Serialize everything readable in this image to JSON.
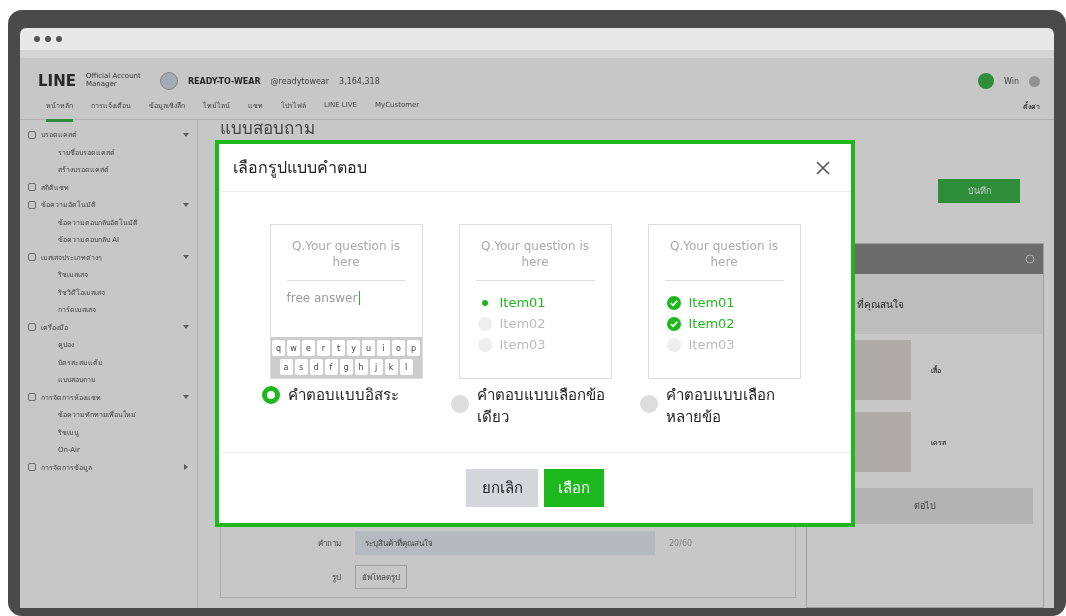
{
  "header": {
    "brand": "LINE",
    "brand_sub": "Official Account Manager",
    "account_name": "READY-TO-WEAR",
    "account_id": "@readytowear",
    "friends": "3,164,318",
    "user": "Win",
    "settings": "ตั้งค่า"
  },
  "nav": [
    {
      "label": "หน้าหลัก",
      "selected": true
    },
    {
      "label": "การแจ้งเตือน",
      "selected": false
    },
    {
      "label": "ข้อมูลเชิงลึก",
      "selected": false
    },
    {
      "label": "ไทม์ไลน์",
      "selected": false
    },
    {
      "label": "แชท",
      "selected": false
    },
    {
      "label": "โปรไฟล์",
      "selected": false
    },
    {
      "label": "LINE LIVE",
      "selected": false
    },
    {
      "label": "MyCustomer",
      "selected": false
    }
  ],
  "sidebar": [
    {
      "label": "บรอดแคสต์",
      "expanded": true,
      "children": [
        {
          "label": "รายชื่อบรอดแคสต์"
        },
        {
          "label": "สร้างบรอดแคสต์"
        }
      ]
    },
    {
      "label": "สถิติแชท"
    },
    {
      "label": "ข้อความอัตโนมัติ",
      "expanded": true,
      "children": [
        {
          "label": "ข้อความตอบกลับอัตโนมัติ"
        },
        {
          "label": "ข้อความตอบกลับ AI"
        }
      ]
    },
    {
      "label": "เมสเสจประเภทต่างๆ",
      "expanded": true,
      "children": [
        {
          "label": "ริชเมสเสจ"
        },
        {
          "label": "ริชวิดีโอเมสเสจ"
        },
        {
          "label": "การ์ดเมสเสจ"
        }
      ]
    },
    {
      "label": "เครื่องมือ",
      "expanded": true,
      "children": [
        {
          "label": "คูปอง"
        },
        {
          "label": "บัตรสะสมแต้ม"
        },
        {
          "label": "แบบสอบถาม"
        }
      ]
    },
    {
      "label": "การจัดการห้องแชท",
      "expanded": true,
      "children": [
        {
          "label": "ข้อความทักทายเพื่อนใหม่"
        },
        {
          "label": "ริชเมนู"
        },
        {
          "label": "On-Air"
        }
      ]
    },
    {
      "label": "การจัดการข้อมูล",
      "expanded": false
    }
  ],
  "page": {
    "title": "แบบสอบถาม",
    "save_button": "บันทึก",
    "form": [
      {
        "label": "คำถาม",
        "value": "ระบุสินค้าที่คุณสนใจ",
        "counter": "20/60"
      },
      {
        "label": "รูป",
        "button": "อัพโหลดรูป"
      }
    ],
    "preview": {
      "title": "ที่คุณสนใจ",
      "options": [
        {
          "label": "เสื้อ"
        },
        {
          "label": "เดรส"
        }
      ],
      "next_button": "ต่อไป"
    }
  },
  "modal": {
    "title": "เลือกรูปแบบคำตอบ",
    "options": [
      {
        "kind": "free",
        "question": "Q.Your question is here",
        "answer": "free answer",
        "keys": [
          [
            "q",
            "w",
            "e",
            "r",
            "t",
            "y",
            "u",
            "i",
            "o",
            "p"
          ],
          [
            "a",
            "s",
            "d",
            "f",
            "g",
            "h",
            "j",
            "k",
            "l"
          ]
        ],
        "label": "คำตอบแบบอิสระ",
        "selected": true
      },
      {
        "kind": "single",
        "question": "Q.Your question is here",
        "items": [
          {
            "label": "Item01",
            "selected": true
          },
          {
            "label": "Item02",
            "selected": false
          },
          {
            "label": "Item03",
            "selected": false
          }
        ],
        "label": "คำตอบแบบเลือกข้อเดียว",
        "selected": false
      },
      {
        "kind": "multiple",
        "question": "Q.Your question is here",
        "items": [
          {
            "label": "Item01",
            "checked": true
          },
          {
            "label": "Item02",
            "checked": true
          },
          {
            "label": "Item03",
            "checked": false
          }
        ],
        "label": "คำตอบแบบเลือกหลายข้อ",
        "selected": false
      }
    ],
    "cancel_button": "ยกเลิก",
    "confirm_button": "เลือก"
  }
}
